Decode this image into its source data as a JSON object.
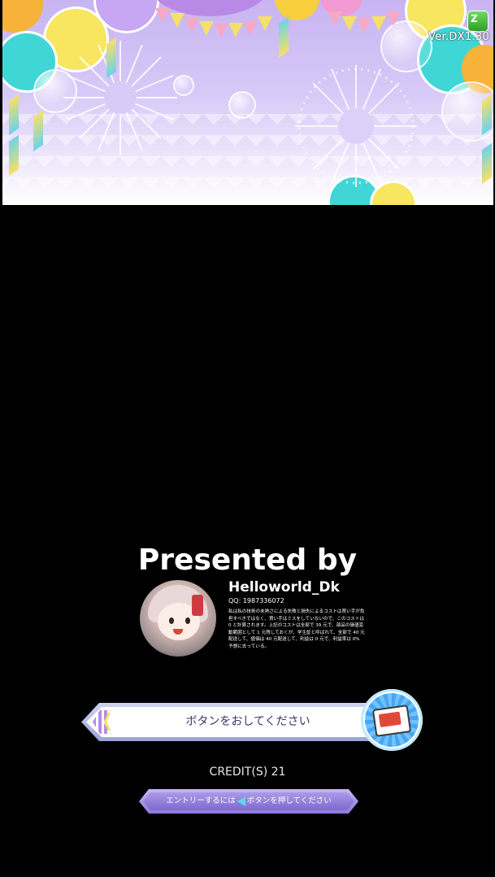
{
  "header": {
    "version": "Ver.DX1.30",
    "logo_icon": "game-logo-icon"
  },
  "presented": {
    "title": "Presented by",
    "author_name": "Helloworld_Dk",
    "qq": "QQ: 1987336072",
    "note": "私は私の技術の未熟さによる失敗と損失によるコストは買い手が負担すべきではなく、買い手はミスをしていないので、このコストは 0 と計算されます。上記のコストは全部で 39 元で、部品の価値変動範囲として 1 元残しておくが、学生証と呼ばれて、全部で 40 元配送して、値価は 40 元配送して、利益は 0 元で、利益率は 0% 予想に去っている。"
  },
  "press_button": {
    "label": "ボタンをおしてください",
    "icon": "card-icon"
  },
  "credit": {
    "text": "CREDIT(S)  21"
  },
  "entry": {
    "before": "エントリーするには",
    "after": "ボタンを押してください",
    "arrow_icon": "left-arrow-icon"
  },
  "colors": {
    "banner_purple": "#c7b4f2",
    "bar_text": "#3c3366",
    "arrow_cyan": "#60d7ee"
  }
}
